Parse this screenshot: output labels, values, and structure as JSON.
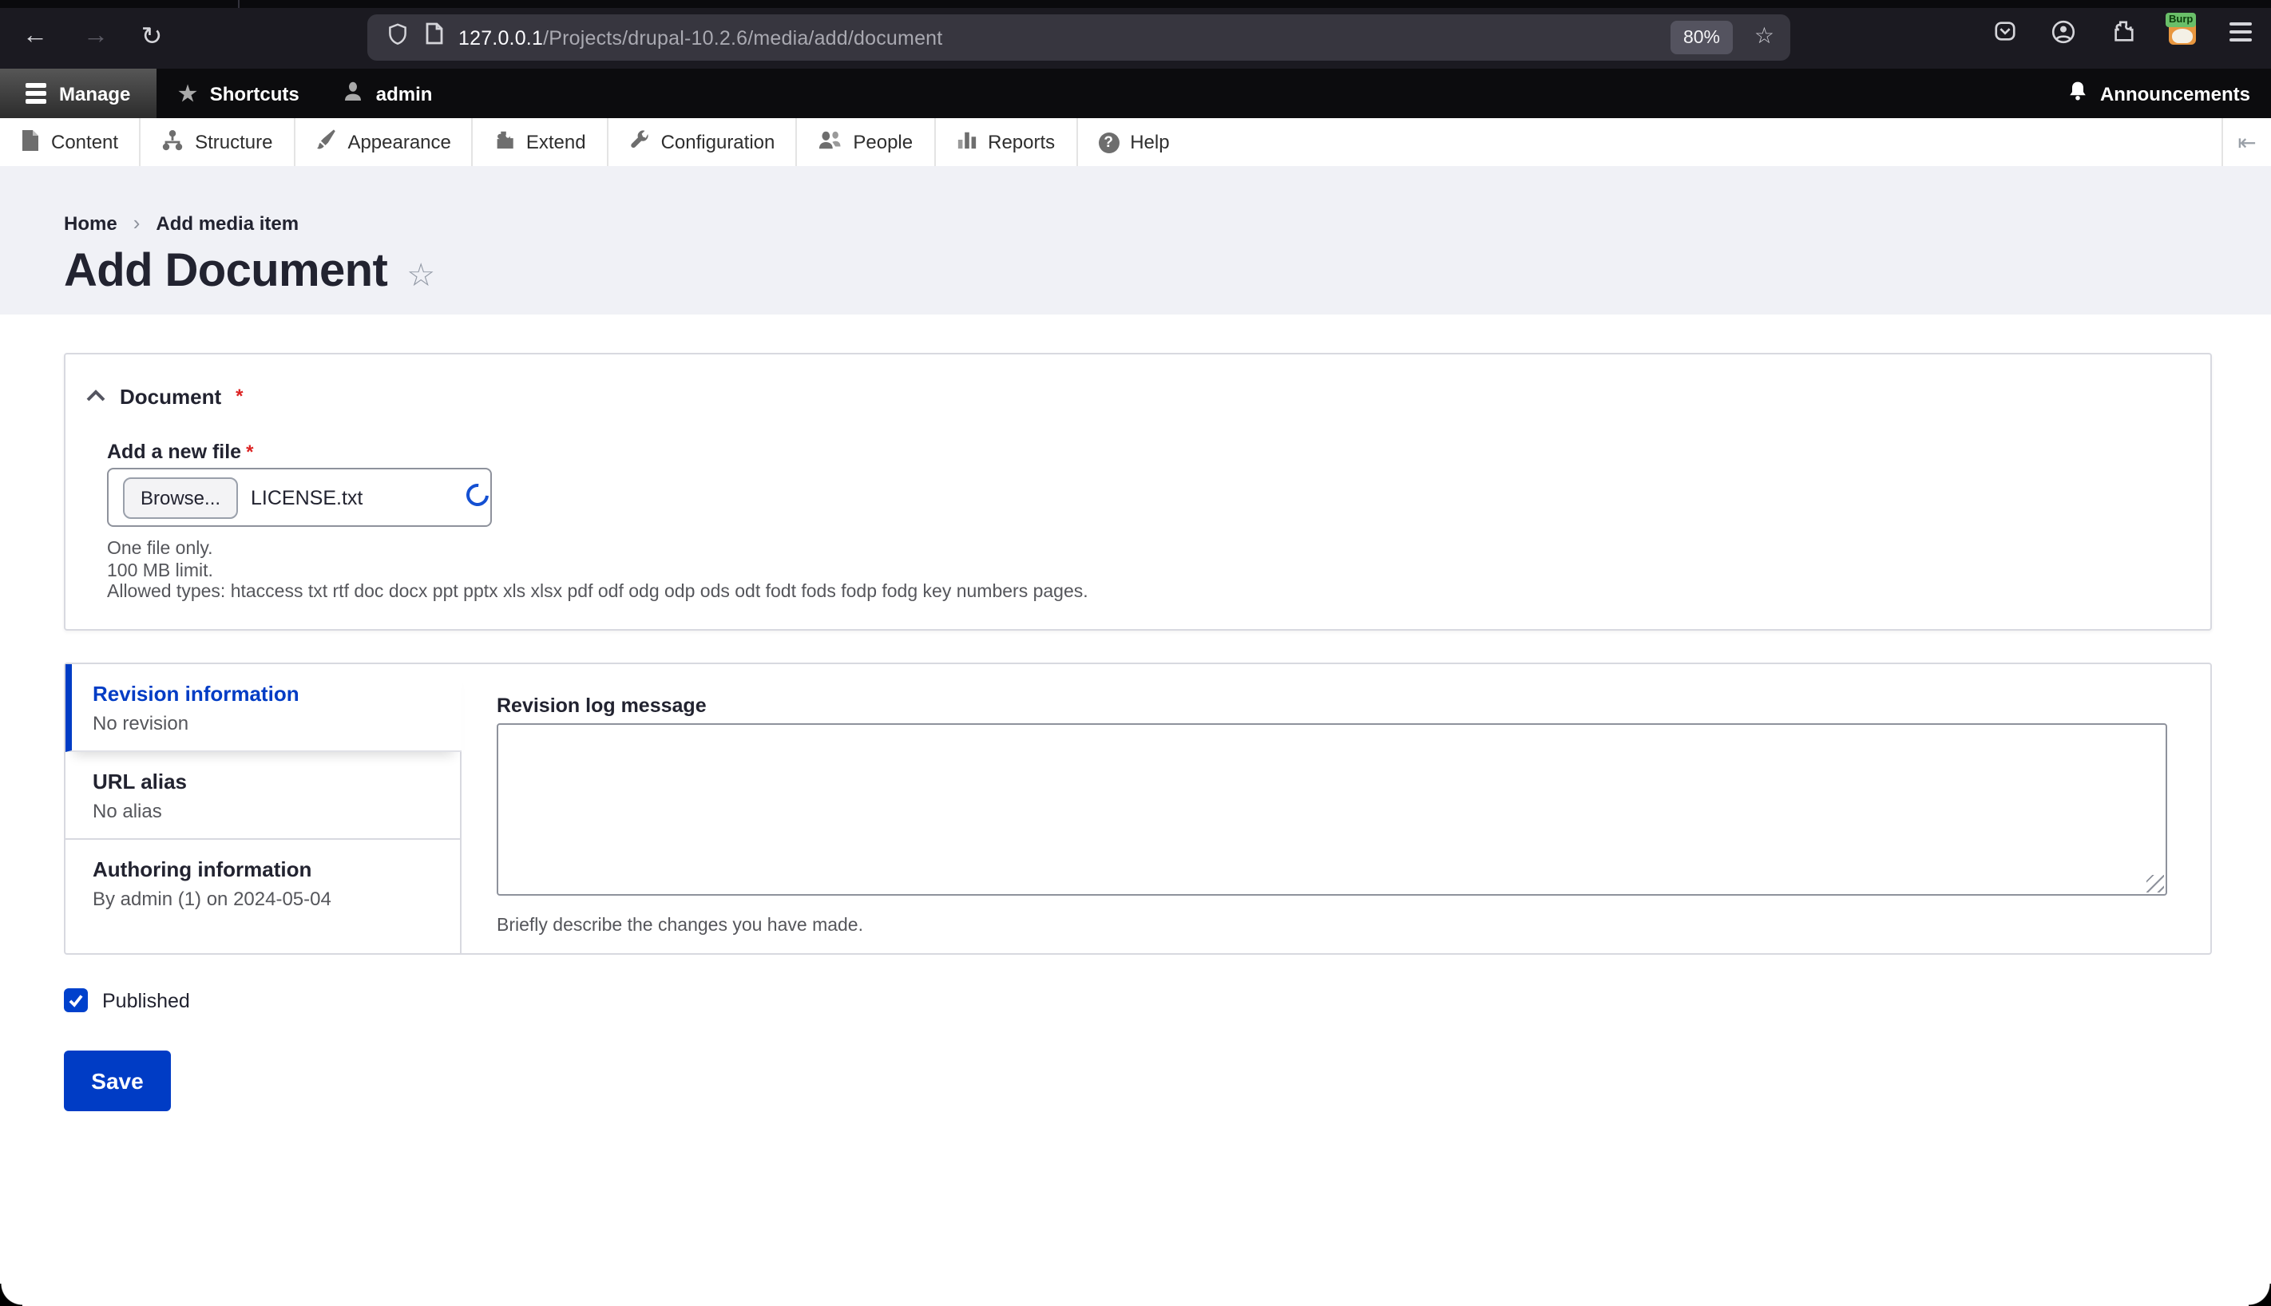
{
  "browser": {
    "url_host": "127.0.0.1",
    "url_path": "/Projects/drupal-10.2.6/media/add/document",
    "zoom_badge": "80%",
    "bookmark_star_glyph": "☆",
    "extension_label": "Burp",
    "back_glyph": "←",
    "forward_glyph": "→",
    "reload_glyph": "↻"
  },
  "admin_toolbar": {
    "manage_label": "Manage",
    "shortcuts_label": "Shortcuts",
    "shortcuts_star_glyph": "★",
    "user_label": "admin",
    "announcements_label": "Announcements"
  },
  "menu": {
    "items": [
      {
        "label": "Content",
        "icon": "content-icon"
      },
      {
        "label": "Structure",
        "icon": "structure-icon"
      },
      {
        "label": "Appearance",
        "icon": "appearance-icon"
      },
      {
        "label": "Extend",
        "icon": "extend-icon"
      },
      {
        "label": "Configuration",
        "icon": "configuration-icon"
      },
      {
        "label": "People",
        "icon": "people-icon"
      },
      {
        "label": "Reports",
        "icon": "reports-icon"
      },
      {
        "label": "Help",
        "icon": "help-icon"
      }
    ],
    "help_glyph": "?",
    "collapse_toggle_glyph": "⇤"
  },
  "breadcrumb": {
    "home": "Home",
    "separator": "›",
    "current": "Add media item"
  },
  "page": {
    "title": "Add Document",
    "favorite_star_glyph": "☆"
  },
  "document_fieldset": {
    "legend": "Document",
    "required_marker": "*",
    "file_label": "Add a new file",
    "browse_button": "Browse...",
    "file_name": "LICENSE.txt",
    "help_line_1": "One file only.",
    "help_line_2": "100 MB limit.",
    "help_line_3": "Allowed types: htaccess txt rtf doc docx ppt pptx xls xlsx pdf odf odg odp ods odt fodt fods fodp fodg key numbers pages."
  },
  "vertical_tabs": {
    "tabs": [
      {
        "title": "Revision information",
        "summary": "No revision"
      },
      {
        "title": "URL alias",
        "summary": "No alias"
      },
      {
        "title": "Authoring information",
        "summary": "By admin (1) on 2024-05-04"
      }
    ],
    "panel": {
      "label": "Revision log message",
      "textarea_value": "",
      "hint": "Briefly describe the changes you have made."
    }
  },
  "publish": {
    "label": "Published",
    "checked": true
  },
  "actions": {
    "save_label": "Save"
  },
  "colors": {
    "accent": "#003cc5",
    "required": "#dc2323",
    "header_bg": "#f0f1f6",
    "toolbar_bg": "#0c0c0e"
  }
}
